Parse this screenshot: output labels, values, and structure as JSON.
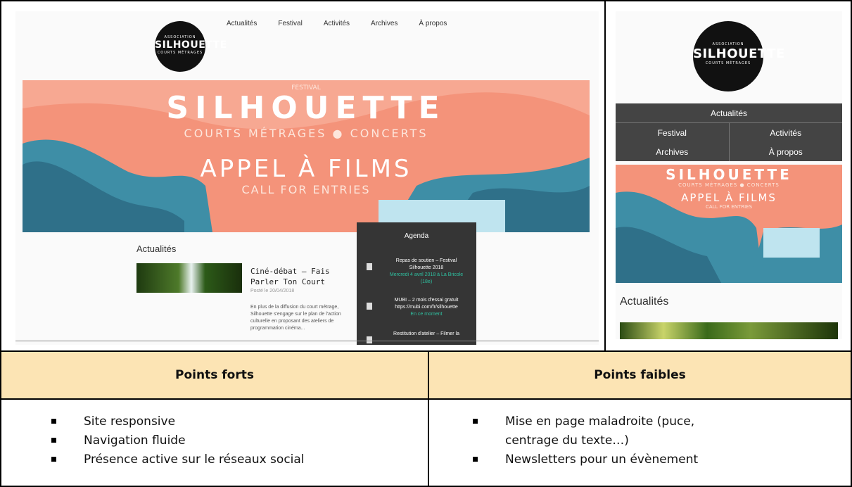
{
  "desktop": {
    "nav": [
      "Actualités",
      "Festival",
      "Activités",
      "Archives",
      "À propos"
    ],
    "logo": {
      "small": "ASSOCIATION",
      "big": "SILHOUETTE",
      "sub": "COURTS MÉTRAGES"
    },
    "banner": {
      "kicker": "FESTIVAL",
      "title": "SILHOUETTE",
      "sub": "COURTS MÉTRAGES ● CONCERTS",
      "call": "APPEL À FILMS",
      "call_sub": "CALL FOR ENTRIES"
    },
    "news": {
      "heading": "Actualités",
      "post_title": "Ciné-débat – Fais Parler Ton Court",
      "post_date": "Posté le 20/04/2018",
      "post_excerpt": "En plus de la diffusion du court métrage, Silhouette s'engage sur le plan de l'action culturelle en proposant des ateliers de programmation cinéma..."
    },
    "agenda": {
      "title": "Agenda",
      "items": [
        {
          "text": "Repas de soutien – Festival Silhouette 2018",
          "date": "Mercredi 4 avril 2018 à La Bricole (18e)"
        },
        {
          "text": "MUBI – 2 mois d'essai gratuit https://mubi.com/fr/silhouette",
          "date": "En ce moment"
        },
        {
          "text": "Restitution d'atelier – Filmer la",
          "date": ""
        }
      ]
    }
  },
  "mobile": {
    "logo": {
      "small": "ASSOCIATION",
      "big": "SILHOUETTE",
      "sub": "COURTS MÉTRAGES"
    },
    "nav": {
      "top": "Actualités",
      "row1": [
        "Festival",
        "Activités"
      ],
      "row2": [
        "Archives",
        "À propos"
      ]
    },
    "banner": {
      "title": "SILHOUETTE",
      "sub": "COURTS MÉTRAGES ● CONCERTS",
      "call": "APPEL À FILMS",
      "call_sub": "CALL FOR ENTRIES"
    },
    "news_heading": "Actualités"
  },
  "table": {
    "headers": [
      "Points forts",
      "Points faibles"
    ],
    "strengths": [
      "Site responsive",
      "Navigation fluide",
      "Présence active sur le réseaux social"
    ],
    "weaknesses": [
      "Mise en page maladroite (puce, centrage du texte…)",
      "Newsletters pour un évènement"
    ]
  },
  "colors": {
    "header_bg": "#fce4b4",
    "banner_salmon": "#f4937a",
    "banner_teal": "#3e8ea6",
    "agenda_bg": "#353535",
    "agenda_date": "#2fc0a0"
  }
}
